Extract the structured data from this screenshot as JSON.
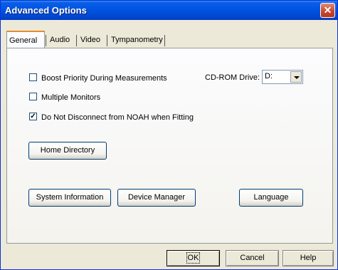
{
  "window": {
    "title": "Advanced Options"
  },
  "tabs": [
    {
      "label": "General",
      "active": true
    },
    {
      "label": "Audio",
      "active": false
    },
    {
      "label": "Video",
      "active": false
    },
    {
      "label": "Tympanometry",
      "active": false
    }
  ],
  "general": {
    "checkboxes": [
      {
        "label": "Boost Priority During Measurements",
        "checked": false
      },
      {
        "label": "Multiple Monitors",
        "checked": false
      },
      {
        "label": "Do Not Disconnect from NOAH when Fitting",
        "checked": true
      }
    ],
    "cdrom": {
      "label": "CD-ROM Drive:",
      "value": "D:"
    },
    "buttons": {
      "home_directory": "Home Directory",
      "system_information": "System Information",
      "device_manager": "Device Manager",
      "language": "Language"
    }
  },
  "footer": {
    "ok": "OK",
    "cancel": "Cancel",
    "help": "Help"
  },
  "icons": {
    "close": "close-icon",
    "check": "check-icon",
    "dropdown": "chevron-down-icon"
  },
  "colors": {
    "titlebar": "#0054e3",
    "close": "#c8442b",
    "face": "#ece9d8",
    "tab_highlight": "#e68b2c"
  }
}
